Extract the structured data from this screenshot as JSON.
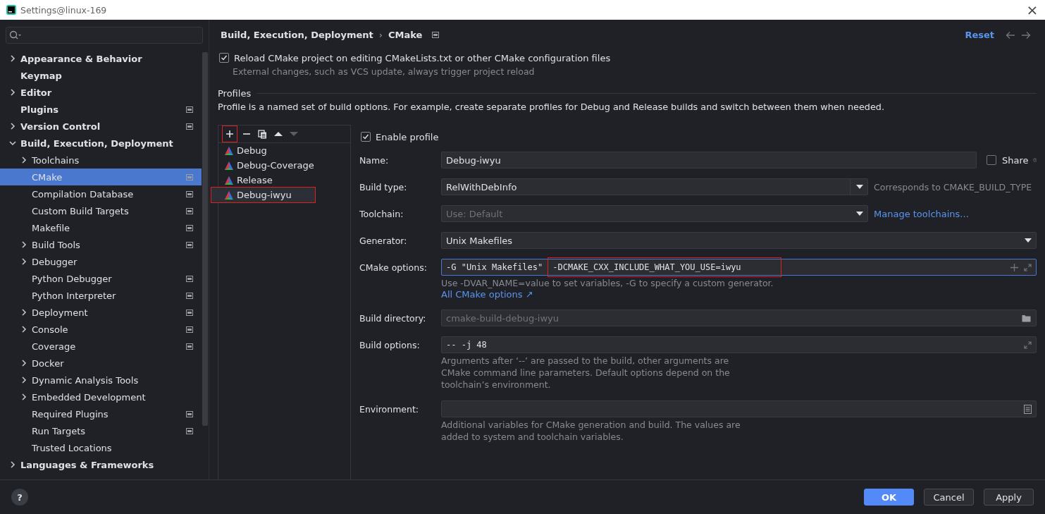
{
  "window": {
    "title": "Settings@linux-169",
    "close": "×"
  },
  "sidebar": {
    "items": [
      {
        "label": "Appearance & Behavior",
        "kind": "folder",
        "expanded": false,
        "project_level": false,
        "selected": false
      },
      {
        "label": "Keymap",
        "kind": "page",
        "project_level": false,
        "selected": false
      },
      {
        "label": "Editor",
        "kind": "folder",
        "expanded": false,
        "project_level": false,
        "selected": false
      },
      {
        "label": "Plugins",
        "kind": "page",
        "project_level": true,
        "selected": false
      },
      {
        "label": "Version Control",
        "kind": "folder",
        "expanded": false,
        "project_level": true,
        "selected": false
      },
      {
        "label": "Build, Execution, Deployment",
        "kind": "folder",
        "expanded": true,
        "project_level": false,
        "selected": false,
        "children": [
          {
            "label": "Toolchains",
            "kind": "folder",
            "expanded": false,
            "project_level": false,
            "selected": false
          },
          {
            "label": "CMake",
            "kind": "page",
            "project_level": true,
            "selected": true
          },
          {
            "label": "Compilation Database",
            "kind": "page",
            "project_level": true,
            "selected": false
          },
          {
            "label": "Custom Build Targets",
            "kind": "page",
            "project_level": true,
            "selected": false
          },
          {
            "label": "Makefile",
            "kind": "page",
            "project_level": true,
            "selected": false
          },
          {
            "label": "Build Tools",
            "kind": "folder",
            "expanded": false,
            "project_level": true,
            "selected": false
          },
          {
            "label": "Debugger",
            "kind": "folder",
            "expanded": false,
            "project_level": false,
            "selected": false
          },
          {
            "label": "Python Debugger",
            "kind": "page",
            "project_level": true,
            "selected": false
          },
          {
            "label": "Python Interpreter",
            "kind": "page",
            "project_level": true,
            "selected": false
          },
          {
            "label": "Deployment",
            "kind": "folder",
            "expanded": false,
            "project_level": true,
            "selected": false
          },
          {
            "label": "Console",
            "kind": "folder",
            "expanded": false,
            "project_level": true,
            "selected": false
          },
          {
            "label": "Coverage",
            "kind": "page",
            "project_level": true,
            "selected": false
          },
          {
            "label": "Docker",
            "kind": "folder",
            "expanded": false,
            "project_level": false,
            "selected": false
          },
          {
            "label": "Dynamic Analysis Tools",
            "kind": "folder",
            "expanded": false,
            "project_level": false,
            "selected": false
          },
          {
            "label": "Embedded Development",
            "kind": "folder",
            "expanded": false,
            "project_level": false,
            "selected": false
          },
          {
            "label": "Required Plugins",
            "kind": "page",
            "project_level": true,
            "selected": false
          },
          {
            "label": "Run Targets",
            "kind": "page",
            "project_level": true,
            "selected": false
          },
          {
            "label": "Trusted Locations",
            "kind": "page",
            "project_level": false,
            "selected": false
          }
        ]
      },
      {
        "label": "Languages & Frameworks",
        "kind": "folder",
        "expanded": false,
        "project_level": false,
        "selected": false
      }
    ]
  },
  "breadcrumb": {
    "parent": "Build, Execution, Deployment",
    "separator": "›",
    "current": "CMake",
    "reset": "Reset"
  },
  "reload": {
    "label": "Reload CMake project on editing CMakeLists.txt or other CMake configuration files",
    "checked": true,
    "hint": "External changes, such as VCS update, always trigger project reload"
  },
  "profiles_section": {
    "title": "Profiles",
    "description": "Profile is a named set of build options. For example, create separate profiles for Debug and Release builds and switch between them when needed."
  },
  "toolbar": {
    "add_highlighted": true
  },
  "profiles": [
    {
      "name": "Debug",
      "selected": false,
      "highlighted": false
    },
    {
      "name": "Debug-Coverage",
      "selected": false,
      "highlighted": false
    },
    {
      "name": "Release",
      "selected": false,
      "highlighted": false
    },
    {
      "name": "Debug-iwyu",
      "selected": true,
      "highlighted": true
    }
  ],
  "form": {
    "enable": {
      "label": "Enable profile",
      "checked": true
    },
    "name": {
      "label": "Name:",
      "value": "Debug-iwyu",
      "share": "Share",
      "share_checked": false
    },
    "build_type": {
      "label": "Build type:",
      "value": "RelWithDebInfo",
      "note": "Corresponds to CMAKE_BUILD_TYPE"
    },
    "toolchain": {
      "label": "Toolchain:",
      "placeholder": "Use: Default",
      "link": "Manage toolchains..."
    },
    "generator": {
      "label": "Generator:",
      "value": "Unix Makefiles"
    },
    "cmake_options": {
      "label": "CMake options:",
      "segments": [
        {
          "text": "-G \"Unix Makefiles\"",
          "highlighted": false
        },
        {
          "text": "-DCMAKE_CXX_INCLUDE_WHAT_YOU_USE=iwyu",
          "highlighted": true
        }
      ],
      "hint": "Use -DVAR_NAME=value to set variables, -G to specify a custom generator.",
      "link": "All CMake options ↗"
    },
    "build_directory": {
      "label": "Build directory:",
      "placeholder": "cmake-build-debug-iwyu"
    },
    "build_options": {
      "label": "Build options:",
      "value": "-- -j 48",
      "hint": [
        "Arguments after ‘--’ are passed to the build, other arguments are",
        "CMake command line parameters. Default options depend on the",
        "toolchain’s environment."
      ]
    },
    "environment": {
      "label": "Environment:",
      "hint": [
        "Additional variables for CMake generation and build. The values are",
        "added to system and toolchain variables."
      ]
    }
  },
  "buttons": [
    {
      "label": "OK",
      "kind": "primary"
    },
    {
      "label": "Cancel",
      "kind": "normal"
    },
    {
      "label": "Apply",
      "kind": "normal"
    }
  ],
  "help": "?"
}
